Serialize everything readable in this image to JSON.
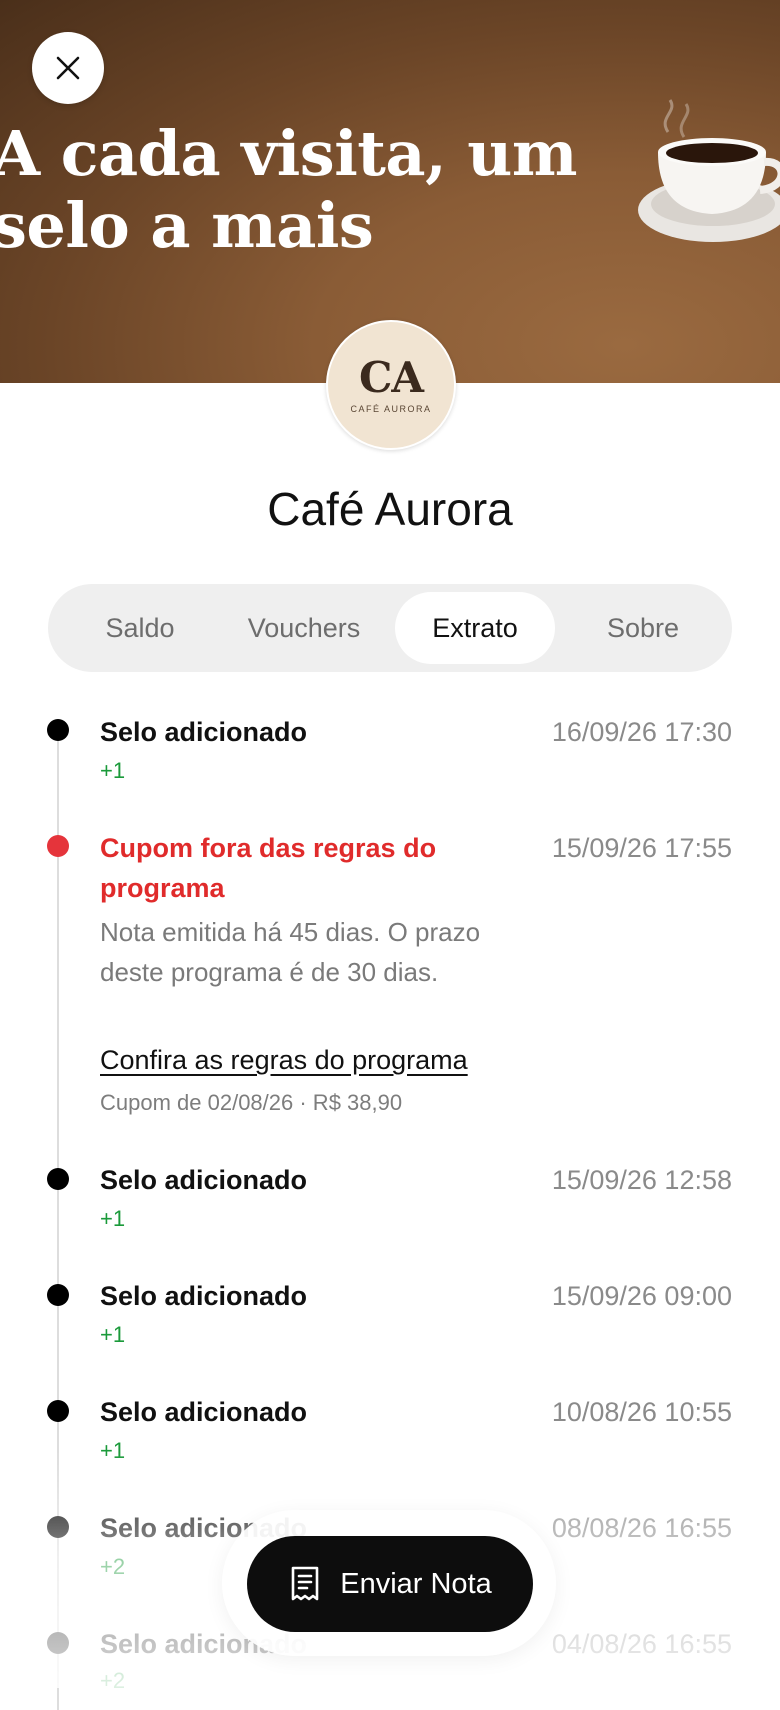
{
  "hero": {
    "title_line1": "A cada visita, um",
    "title_line2": "selo a mais"
  },
  "icons": {
    "close": "close-icon",
    "coffee": "coffee-cup-icon",
    "receipt": "receipt-icon"
  },
  "logo": {
    "monogram": "CA",
    "subtitle": "CAFÉ AURORA"
  },
  "store": {
    "name": "Café Aurora"
  },
  "tabs": [
    {
      "label": "Saldo",
      "active": false
    },
    {
      "label": "Vouchers",
      "active": false
    },
    {
      "label": "Extrato",
      "active": true
    },
    {
      "label": "Sobre",
      "active": false
    }
  ],
  "events": [
    {
      "title": "Selo adicionado",
      "date": "16/09/26 17:30",
      "delta": "+1"
    },
    {
      "title": "Cupom fora das regras do programa",
      "date": "15/09/26 17:55",
      "description": "Nota emitida há 45 dias. O prazo deste programa é de 30 dias.",
      "link": "Confira as regras do programa",
      "meta": "Cupom de 02/08/26 · R$ 38,90",
      "status": "error"
    },
    {
      "title": "Selo adicionado",
      "date": "15/09/26 12:58",
      "delta": "+1"
    },
    {
      "title": "Selo adicionado",
      "date": "15/09/26 09:00",
      "delta": "+1"
    },
    {
      "title": "Selo adicionado",
      "date": "10/08/26 10:55",
      "delta": "+1"
    },
    {
      "title": "Selo adicionado",
      "date": "08/08/26 16:55",
      "delta": "+2"
    },
    {
      "title": "Selo adicionado",
      "date": "04/08/26 16:55",
      "delta": "+2"
    }
  ],
  "actions": {
    "send_receipt": "Enviar Nota"
  },
  "colors": {
    "error": "#e02b2b",
    "positive": "#1a9a3a",
    "hero_brown": "#8a5c36",
    "button_dark": "#0d0d0d"
  }
}
